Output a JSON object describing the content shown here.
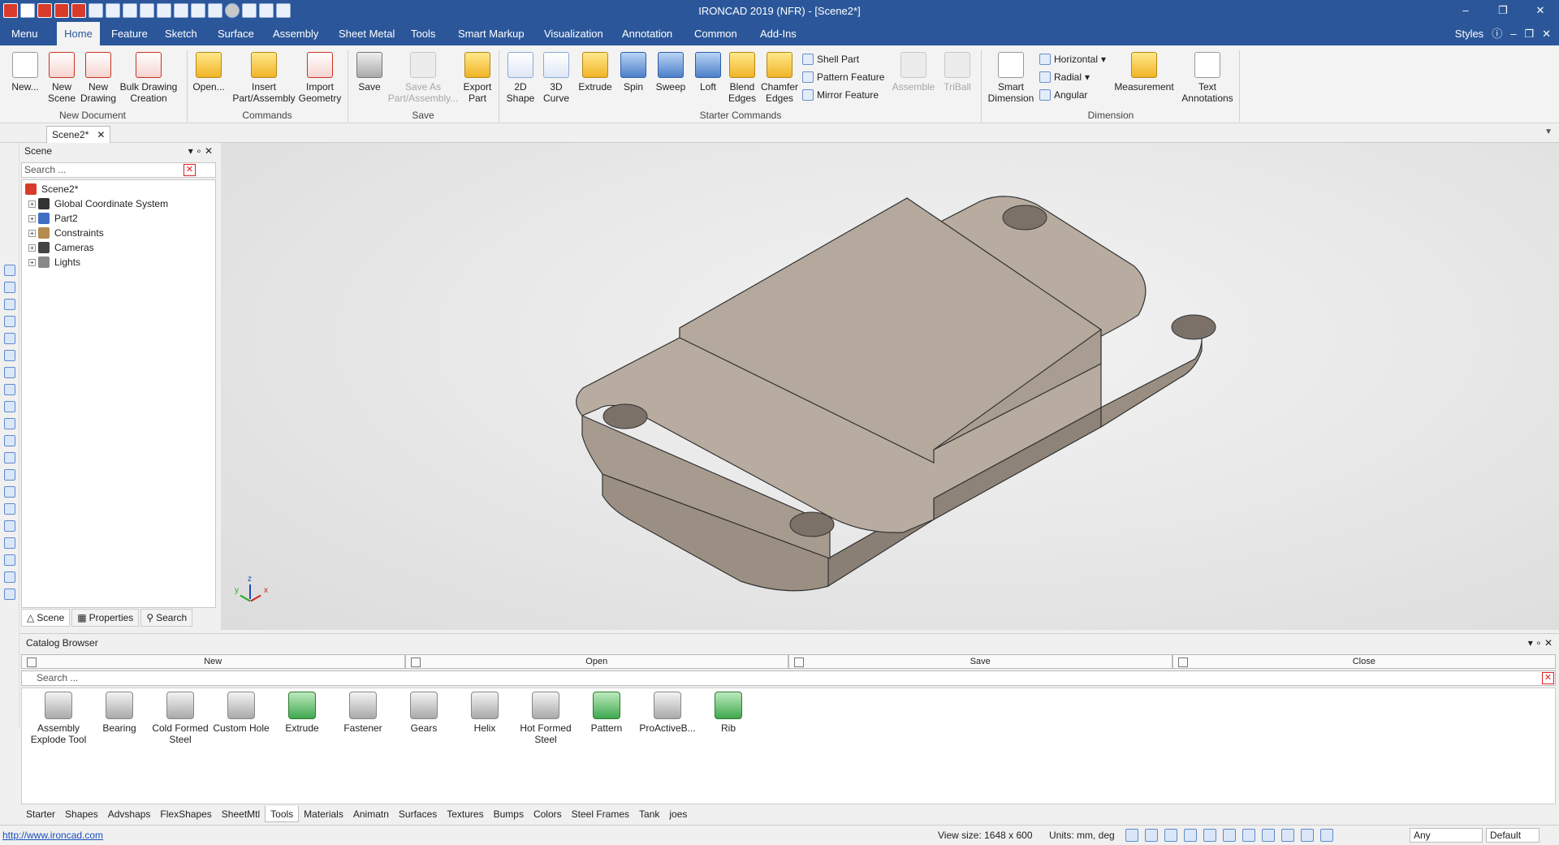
{
  "window": {
    "title": "IRONCAD 2019 (NFR) - [Scene2*]"
  },
  "menu": {
    "tabs": [
      "Menu",
      "Home",
      "Feature",
      "Sketch",
      "Surface",
      "Assembly",
      "Sheet Metal",
      "Tools",
      "Smart Markup",
      "Visualization",
      "Annotation",
      "Common",
      "Add-Ins"
    ],
    "styles": "Styles"
  },
  "ribbon": {
    "new_document": {
      "group": "New Document",
      "new": "New...",
      "new_scene": "New Scene",
      "new_drawing": "New Drawing",
      "bulk": "Bulk Drawing Creation"
    },
    "commands": {
      "group": "Commands",
      "open": "Open...",
      "insert": "Insert Part/Assembly",
      "import": "Import Geometry"
    },
    "save": {
      "group": "Save",
      "save": "Save",
      "save_as": "Save As Part/Assembly...",
      "export": "Export Part"
    },
    "starter": {
      "group": "Starter Commands",
      "shape2d": "2D Shape",
      "curve3d": "3D Curve",
      "extrude": "Extrude",
      "spin": "Spin",
      "sweep": "Sweep",
      "loft": "Loft",
      "blend": "Blend Edges",
      "chamfer": "Chamfer Edges",
      "shell": "Shell Part",
      "pattern": "Pattern Feature",
      "mirror": "Mirror Feature",
      "assemble": "Assemble",
      "triball": "TriBall"
    },
    "dimension": {
      "group": "Dimension",
      "smart": "Smart Dimension",
      "horizontal": "Horizontal",
      "radial": "Radial",
      "angular": "Angular",
      "measurement": "Measurement",
      "text": "Text Annotations"
    }
  },
  "doc_tab": {
    "label": "Scene2*"
  },
  "scene_panel": {
    "title": "Scene",
    "search_placeholder": "Search ...",
    "root": "Scene2*",
    "items": [
      "Global Coordinate System",
      "Part2",
      "Constraints",
      "Cameras",
      "Lights"
    ],
    "tabs": [
      "Scene",
      "Properties",
      "Search"
    ]
  },
  "viewport": {
    "axes": {
      "z": "z",
      "x": "x",
      "y": "y"
    }
  },
  "catalog": {
    "title": "Catalog Browser",
    "actions": [
      "New",
      "Open",
      "Save",
      "Close"
    ],
    "search_placeholder": "Search ...",
    "items": [
      "Assembly Explode Tool",
      "Bearing",
      "Cold Formed Steel",
      "Custom Hole",
      "Extrude",
      "Fastener",
      "Gears",
      "Helix",
      "Hot Formed Steel",
      "Pattern",
      "ProActiveB...",
      "Rib"
    ],
    "tabs": [
      "Starter",
      "Shapes",
      "Advshaps",
      "FlexShapes",
      "SheetMtl",
      "Tools",
      "Materials",
      "Animatn",
      "Surfaces",
      "Textures",
      "Bumps",
      "Colors",
      "Steel Frames",
      "Tank",
      "joes"
    ]
  },
  "status": {
    "url": "http://www.ironcad.com",
    "view_size": "View size: 1648 x  600",
    "units": "Units: mm, deg",
    "filter": "Any",
    "mode": "Default"
  },
  "colors": {
    "accent": "#2b579a",
    "part": "#b8aca0"
  }
}
